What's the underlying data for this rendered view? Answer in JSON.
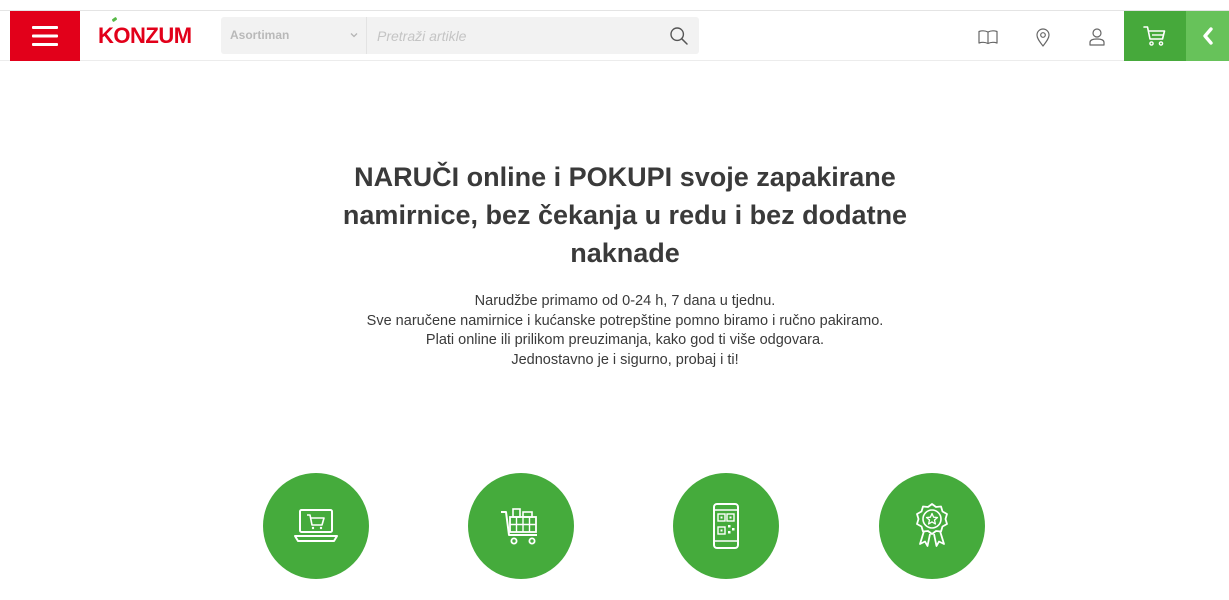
{
  "brand": {
    "logo_text": "KONZUM",
    "colors": {
      "red": "#e2001a",
      "green": "#46a93b",
      "green_light": "#67c25a"
    }
  },
  "header": {
    "menu_icon": "hamburger-menu-icon",
    "search": {
      "category_label": "Asortiman",
      "placeholder": "Pretraži artikle",
      "value": ""
    },
    "icons": [
      "catalog-book-icon",
      "location-pin-icon",
      "user-account-icon",
      "shopping-cart-icon",
      "chevron-left-icon"
    ]
  },
  "hero": {
    "title": "NARUČI online i POKUPI svoje zapakirane namirnice, bez čekanja u redu i bez dodatne naknade",
    "lines": [
      "Narudžbe primamo od 0-24 h, 7 dana u tjednu.",
      "Sve naručene namirnice i kućanske potrepštine pomno biramo i ručno pakiramo.",
      "Plati online ili prilikom preuzimanja, kako god ti više odgovara.",
      "Jednostavno je i sigurno, probaj i ti!"
    ]
  },
  "features": {
    "icons": [
      "laptop-cart-icon",
      "shopping-cart-basket-icon",
      "phone-qr-code-icon",
      "quality-award-badge-icon"
    ]
  }
}
